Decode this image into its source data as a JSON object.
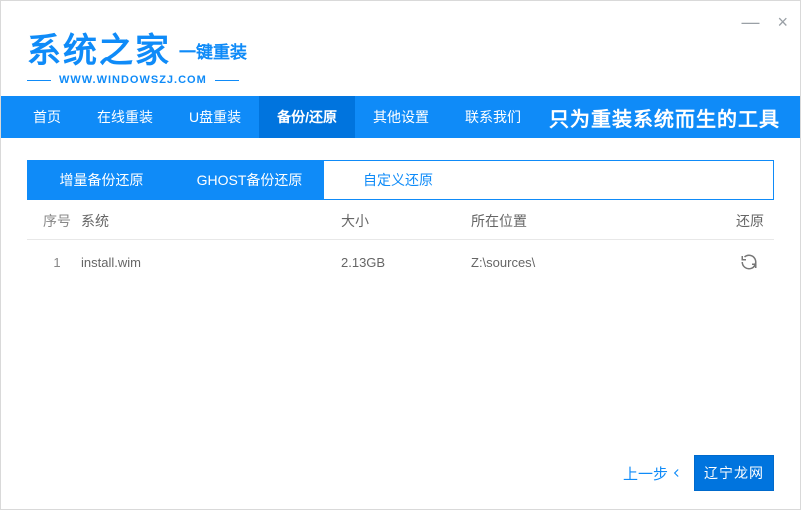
{
  "window": {
    "minimize": "—",
    "close": "×"
  },
  "brand": {
    "title": "系统之家",
    "subtitle": "一键重装",
    "url": "WWW.WINDOWSZJ.COM"
  },
  "nav": {
    "items": [
      {
        "label": "首页",
        "active": false
      },
      {
        "label": "在线重装",
        "active": false
      },
      {
        "label": "U盘重装",
        "active": false
      },
      {
        "label": "备份/还原",
        "active": true
      },
      {
        "label": "其他设置",
        "active": false
      },
      {
        "label": "联系我们",
        "active": false
      }
    ],
    "slogan": "只为重装系统而生的工具"
  },
  "tabs": [
    {
      "label": "增量备份还原",
      "active": false
    },
    {
      "label": "GHOST备份还原",
      "active": false
    },
    {
      "label": "自定义还原",
      "active": true
    }
  ],
  "table": {
    "headers": {
      "index": "序号",
      "system": "系统",
      "size": "大小",
      "location": "所在位置",
      "restore": "还原"
    },
    "rows": [
      {
        "index": "1",
        "system": "install.wim",
        "size": "2.13GB",
        "location": "Z:\\sources\\"
      }
    ]
  },
  "footer": {
    "prev": "上一步",
    "watermark": "辽宁龙网"
  },
  "icons": {
    "restore": "restore-icon",
    "arrow_left": "arrow-left-icon"
  }
}
